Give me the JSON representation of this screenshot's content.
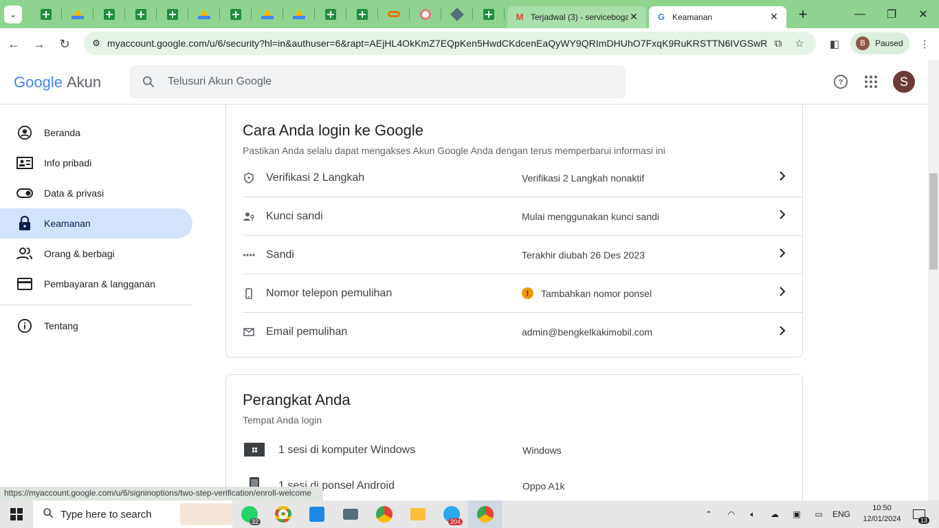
{
  "browser": {
    "tabs": [
      {
        "icon": "gmail-icon",
        "title": "Terjadwal (3) - serviceboga"
      },
      {
        "icon": "google-icon",
        "title": "Keamanan"
      }
    ],
    "url": "myaccount.google.com/u/6/security?hl=in&authuser=6&rapt=AEjHL4OkKmZ7EQpKen5HwdCKdcenEaQyWY9QRImDHUhO7FxqK9RuKRSTTN6IVGSwRK6Z...",
    "profile_avatar": "B",
    "profile_status": "Paused",
    "status_url": "https://myaccount.google.com/u/6/signinoptions/two-step-verification/enroll-welcome"
  },
  "header": {
    "logo_google": "Google",
    "logo_product": "Akun",
    "search_placeholder": "Telusuri Akun Google",
    "user_initial": "S"
  },
  "sidebar": {
    "items": [
      {
        "label": "Beranda"
      },
      {
        "label": "Info pribadi"
      },
      {
        "label": "Data & privasi"
      },
      {
        "label": "Keamanan"
      },
      {
        "label": "Orang & berbagi"
      },
      {
        "label": "Pembayaran & langganan"
      },
      {
        "label": "Tentang"
      }
    ]
  },
  "signin_card": {
    "title": "Cara Anda login ke Google",
    "subtitle": "Pastikan Anda selalu dapat mengakses Akun Google Anda dengan terus memperbarui informasi ini",
    "rows": [
      {
        "label": "Verifikasi 2 Langkah",
        "value": "Verifikasi 2 Langkah nonaktif"
      },
      {
        "label": "Kunci sandi",
        "value": "Mulai menggunakan kunci sandi"
      },
      {
        "label": "Sandi",
        "value": "Terakhir diubah 26 Des 2023"
      },
      {
        "label": "Nomor telepon pemulihan",
        "value": "Tambahkan nomor ponsel"
      },
      {
        "label": "Email pemulihan",
        "value": "admin@bengkelkakimobil.com"
      }
    ]
  },
  "devices_card": {
    "title": "Perangkat Anda",
    "subtitle": "Tempat Anda login",
    "rows": [
      {
        "label": "1 sesi di komputer Windows",
        "value": "Windows"
      },
      {
        "label": "1 sesi di ponsel Android",
        "value": "Oppo A1k"
      }
    ]
  },
  "taskbar": {
    "search_placeholder": "Type here to search",
    "whatsapp_badge": "32",
    "telegram_badge": "204",
    "language": "ENG",
    "time": "10:50",
    "date": "12/01/2024",
    "notifications": "13"
  }
}
